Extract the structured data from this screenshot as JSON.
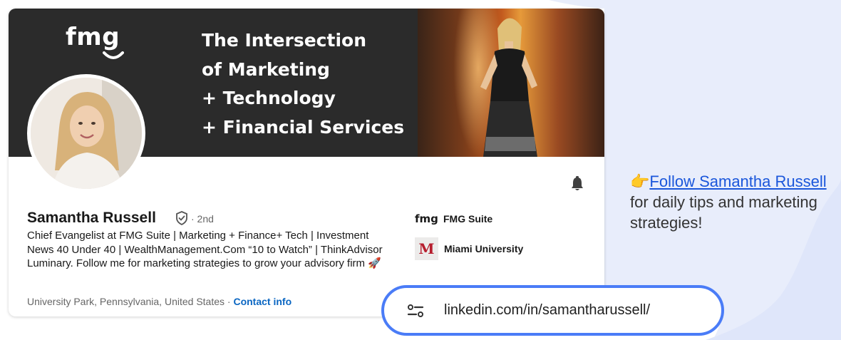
{
  "colors": {
    "background_blob": "#e8edfb",
    "banner": "#2b2b2b",
    "link_blue": "#0a66c2",
    "cta_link": "#1a56db",
    "url_border": "#4a7cf7",
    "miami_red": "#b61e2e"
  },
  "banner": {
    "logo": "fmg",
    "lines": [
      "The Intersection",
      "of Marketing",
      "+ Technology",
      "+ Financial Services"
    ]
  },
  "profile": {
    "name": "Samantha Russell",
    "degree": "· 2nd",
    "headline": "Chief Evangelist at FMG Suite | Marketing + Finance+ Tech | Investment News 40 Under 40 | WealthManagement.Com “10 to Watch” | ThinkAdvisor Luminary. Follow me for marketing strategies to grow your advisory firm 🚀",
    "location": "University Park, Pennsylvania, United States",
    "location_sep": " · ",
    "contact_info": "Contact info",
    "icons": {
      "verified": "verified-shield-icon",
      "bell": "bell-icon"
    }
  },
  "affiliations": [
    {
      "logo": "fmg",
      "label": "FMG Suite"
    },
    {
      "logo": "M",
      "label": "Miami University"
    }
  ],
  "cta": {
    "pointer": "👉",
    "link": "Follow Samantha Russell",
    "rest": " for daily tips and marketing strategies!"
  },
  "url_bar": {
    "icon": "page-info-icon",
    "url": "linkedin.com/in/samantharussell/"
  }
}
